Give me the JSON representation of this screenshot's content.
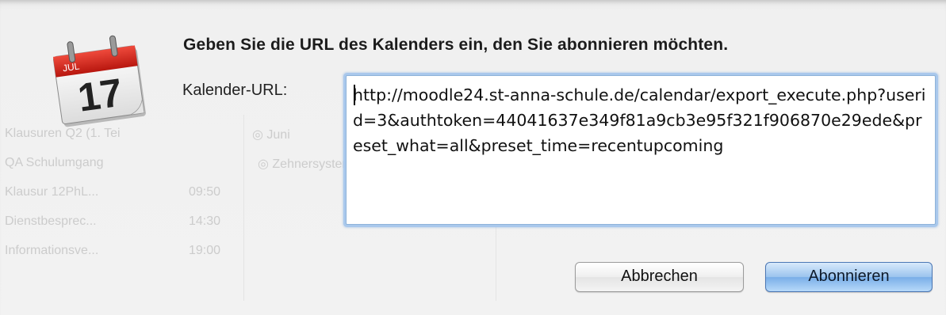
{
  "dialog": {
    "heading": "Geben Sie die URL des Kalenders ein, den Sie abonnieren möchten.",
    "url_label": "Kalender-URL:",
    "url_value": "http://moodle24.st-anna-schule.de/calendar/export_execute.php?userid=3&authtoken=44041637e349f81a9cb3e95f321f906870e29ede&preset_what=all&preset_time=recentupcoming",
    "cancel_label": "Abbrechen",
    "subscribe_label": "Abonnieren"
  },
  "calendar_icon": {
    "month": "JUL",
    "day": "17"
  },
  "background_events": {
    "rows": [
      {
        "title": "Klausuren Q2 (1. Tei",
        "time": ""
      },
      {
        "title": "QA Schulumgang",
        "time": ""
      },
      {
        "title": "Klausur 12PhL...",
        "time": "09:50"
      },
      {
        "title": "Dienstbesprec...",
        "time": "14:30"
      },
      {
        "title": "Informationsve...",
        "time": "19:00"
      }
    ],
    "second_column": [
      "Juni",
      "Zehnersystem"
    ]
  },
  "colors": {
    "focus_ring": "#a9c8ec",
    "default_button": "#79aee8",
    "calendar_red": "#d2261c"
  },
  "icons": {
    "app_icon": "ical-calendar-icon"
  }
}
